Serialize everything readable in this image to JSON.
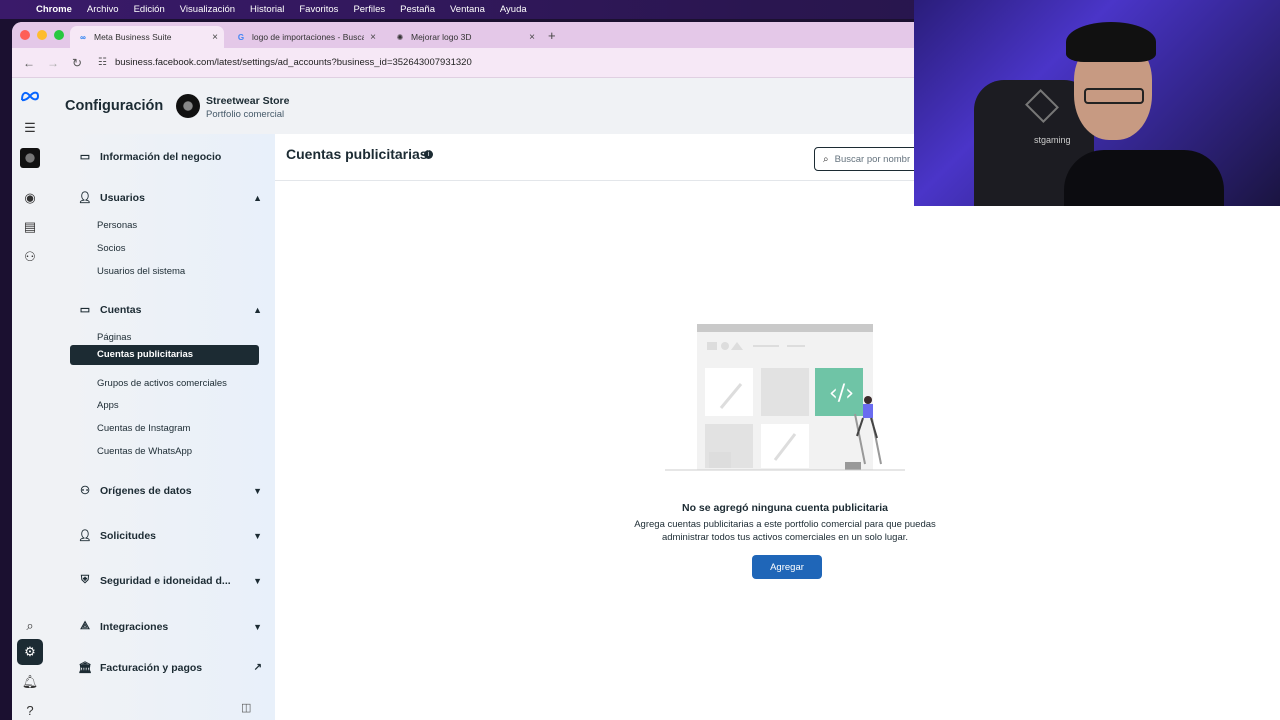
{
  "menubar": {
    "apple_glyph": "",
    "items": [
      "Chrome",
      "Archivo",
      "Edición",
      "Visualización",
      "Historial",
      "Favoritos",
      "Perfiles",
      "Pestaña",
      "Ventana",
      "Ayuda"
    ]
  },
  "browser": {
    "tabs": [
      {
        "title": "Meta Business Suite",
        "icon": "meta-logo-icon",
        "active": true
      },
      {
        "title": "logo de importaciones - Busca",
        "icon": "google-icon",
        "active": false
      },
      {
        "title": "Mejorar logo 3D",
        "icon": "openai-icon",
        "active": false
      }
    ],
    "new_tab_glyph": "+",
    "url": "business.facebook.com/latest/settings/ad_accounts?business_id=352643007931320"
  },
  "header": {
    "title": "Configuración",
    "store_name": "Streetwear Store",
    "store_sub": "Portfolio comercial"
  },
  "sidebar": {
    "business_info": "Información del negocio",
    "users": {
      "label": "Usuarios",
      "items": [
        "Personas",
        "Socios",
        "Usuarios del sistema"
      ]
    },
    "accounts": {
      "label": "Cuentas",
      "items": [
        "Páginas",
        "Cuentas publicitarias",
        "Grupos de activos comerciales",
        "Apps",
        "Cuentas de Instagram",
        "Cuentas de WhatsApp"
      ]
    },
    "data_sources": "Orígenes de datos",
    "requests": "Solicitudes",
    "security": "Seguridad e idoneidad d...",
    "integrations": "Integraciones",
    "billing": "Facturación y pagos"
  },
  "main": {
    "title": "Cuentas publicitarias",
    "search_placeholder": "Buscar por nombr",
    "empty_title": "No se agregó ninguna cuenta publicitaria",
    "empty_desc_line1": "Agrega cuentas publicitarias a este portfolio comercial para que puedas",
    "empty_desc_line2": "administrar todos tus activos comerciales en un solo lugar.",
    "add_button": "Agregar"
  },
  "webcam": {
    "chair_brand": "stgaming"
  },
  "colors": {
    "accent": "#1f66b8",
    "active_item": "#1c2b33"
  }
}
